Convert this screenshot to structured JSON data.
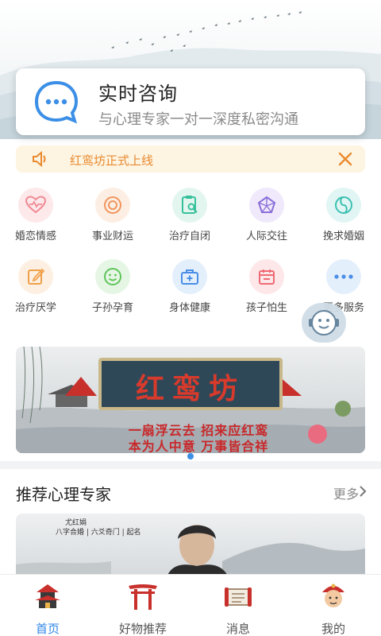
{
  "consult": {
    "title": "实时咨询",
    "subtitle": "与心理专家一对一深度私密沟通"
  },
  "notice": {
    "text": "红鸾坊正式上线"
  },
  "grid": [
    {
      "label": "婚恋情感",
      "icon": "heart-pulse-icon",
      "color": "#f08a95"
    },
    {
      "label": "事业财运",
      "icon": "coin-icon",
      "color": "#f0955c"
    },
    {
      "label": "治疗自闭",
      "icon": "clipboard-search-icon",
      "color": "#37c09a"
    },
    {
      "label": "人际交往",
      "icon": "network-icon",
      "color": "#8b6fd9"
    },
    {
      "label": "挽求婚姻",
      "icon": "yin-yang-icon",
      "color": "#3cc0b2"
    },
    {
      "label": "治疗厌学",
      "icon": "edit-icon",
      "color": "#f0a04a"
    },
    {
      "label": "子孙孕育",
      "icon": "smile-icon",
      "color": "#5ec45a"
    },
    {
      "label": "身体健康",
      "icon": "medkit-icon",
      "color": "#4a8ee8"
    },
    {
      "label": "孩子怕生",
      "icon": "calendar-icon",
      "color": "#ef6a74"
    },
    {
      "label": "更多服务",
      "icon": "more-dots-icon",
      "color": "#4a8ee8"
    }
  ],
  "banner": {
    "title": "红鸾坊",
    "line1": "一扇浮云去 招来应红鸾",
    "line2": "本为人中意 万事皆合祥"
  },
  "section": {
    "title": "推荐心理专家",
    "more": "更多"
  },
  "expert": {
    "calligraphy_1": "尤红娟",
    "calligraphy_2": "八字合婚 | 六爻奇门 | 起名"
  },
  "tabs": [
    {
      "label": "首页",
      "icon": "pagoda-icon",
      "active": true
    },
    {
      "label": "好物推荐",
      "icon": "torii-gate-icon",
      "active": false
    },
    {
      "label": "消息",
      "icon": "scroll-icon",
      "active": false
    },
    {
      "label": "我的",
      "icon": "avatar-icon",
      "active": false
    }
  ],
  "colors": {
    "accent": "#2f86e8",
    "notice_bg": "#fdf4e2",
    "notice_text": "#e98a2e"
  }
}
